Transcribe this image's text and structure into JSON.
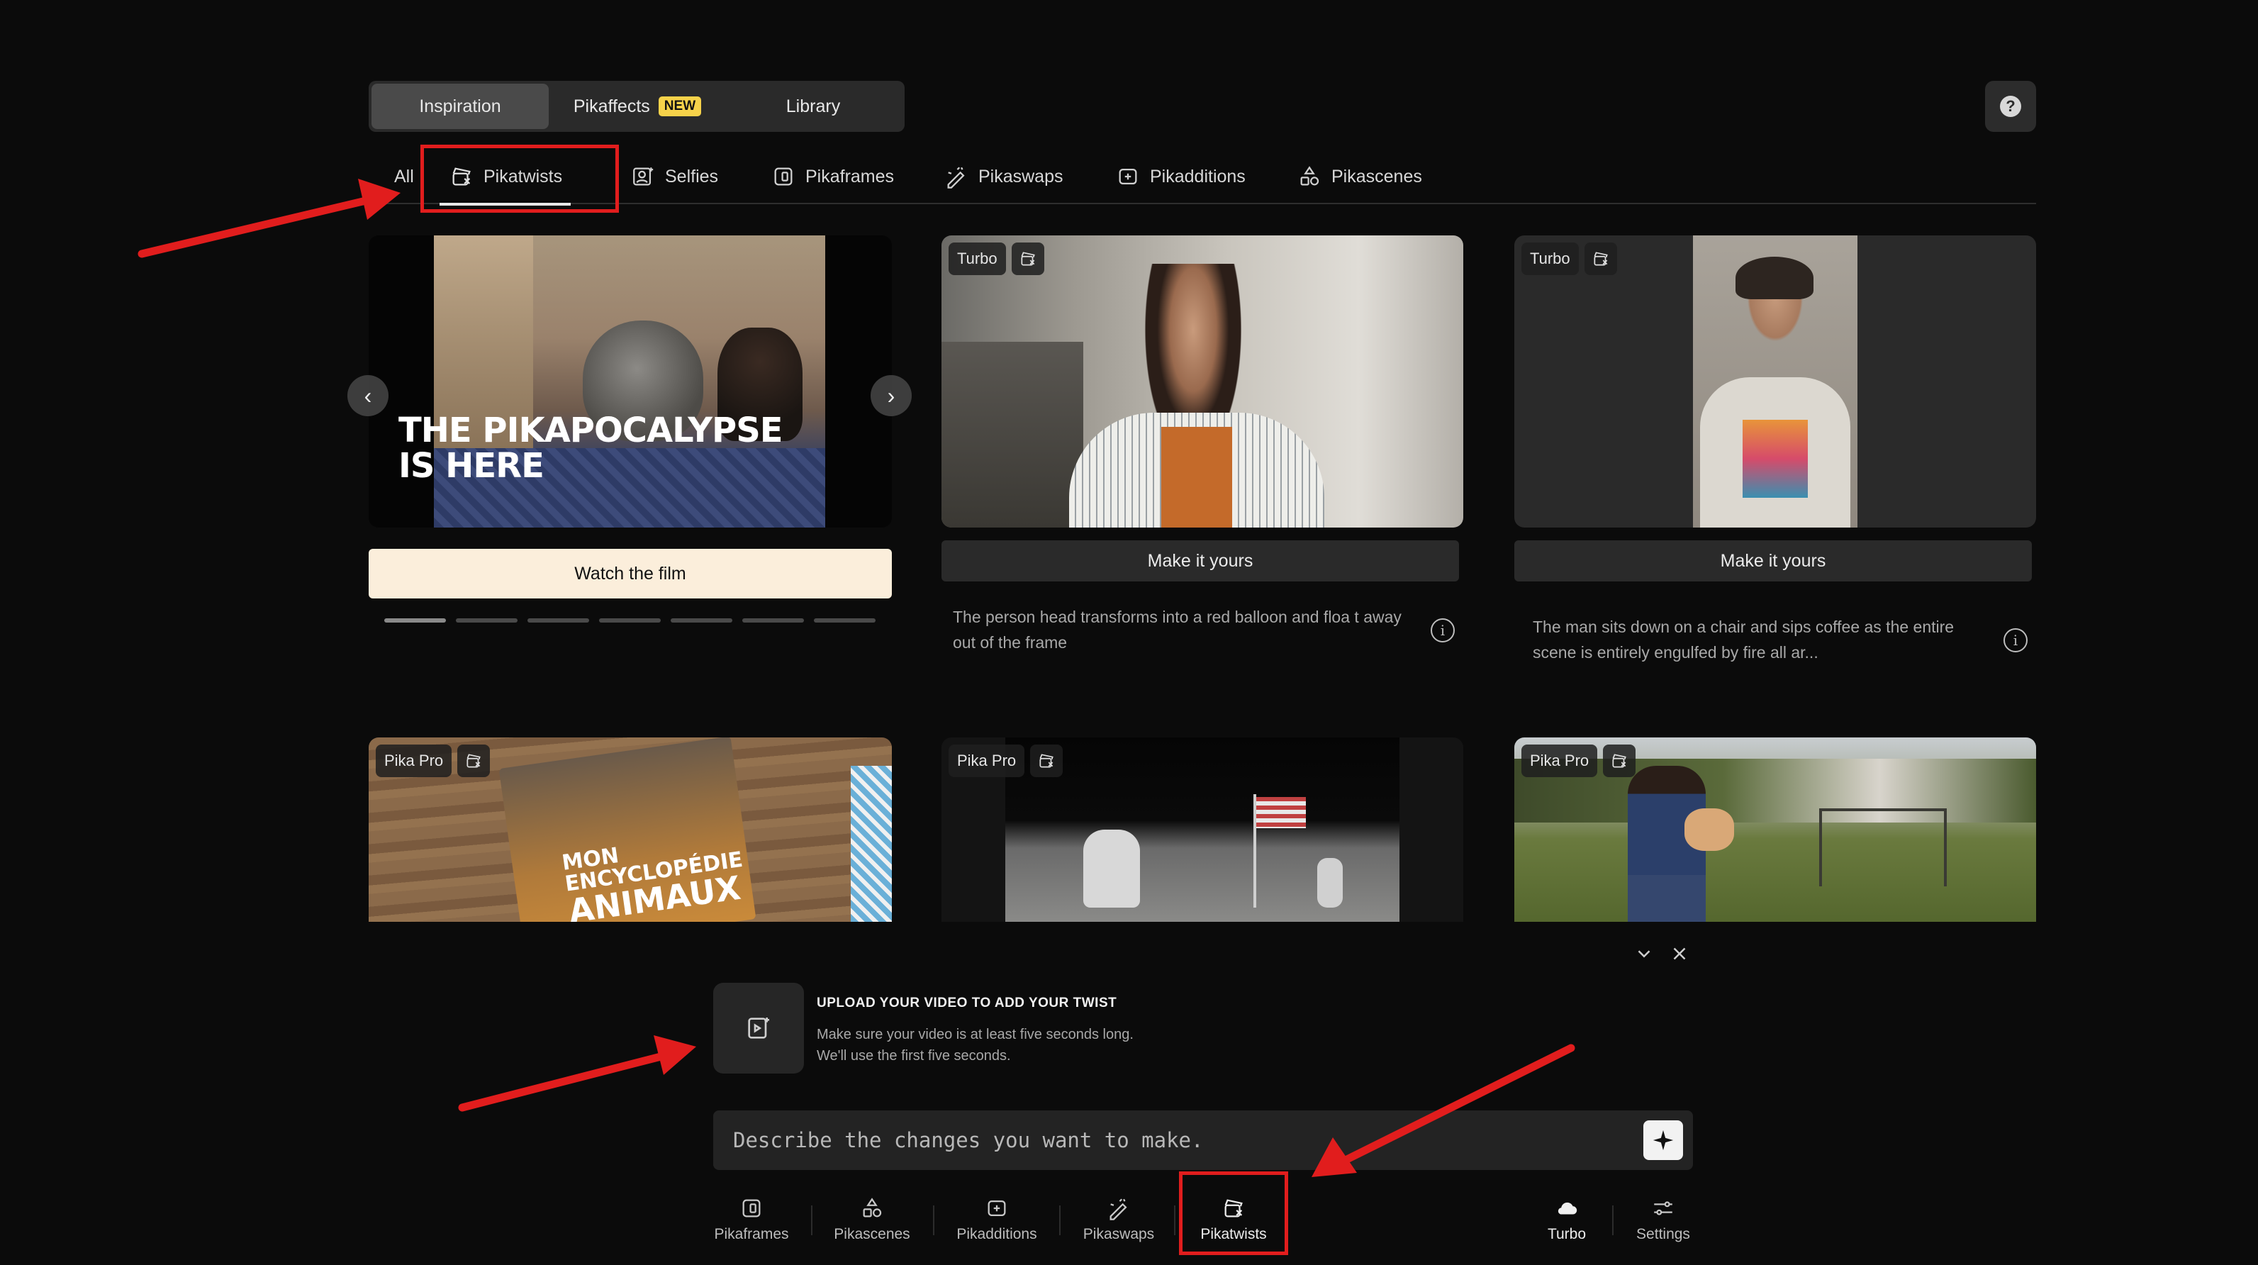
{
  "top_tabs": [
    {
      "label": "Inspiration",
      "active": true
    },
    {
      "label": "Pikaffects",
      "badge": "NEW"
    },
    {
      "label": "Library"
    }
  ],
  "help": {
    "label": "?"
  },
  "categories": [
    {
      "label": "All",
      "icon": ""
    },
    {
      "label": "Pikatwists",
      "icon": "pikatwists-icon",
      "active": true
    },
    {
      "label": "Selfies",
      "icon": "selfie-icon"
    },
    {
      "label": "Pikaframes",
      "icon": "pikaframes-icon"
    },
    {
      "label": "Pikaswaps",
      "icon": "pikaswaps-icon"
    },
    {
      "label": "Pikadditions",
      "icon": "pikadditions-icon"
    },
    {
      "label": "Pikascenes",
      "icon": "pikascenes-icon"
    }
  ],
  "hero": {
    "title_line1": "THE PIKAPOCALYPSE",
    "title_line2": "IS HERE",
    "watch_label": "Watch the film",
    "slide_count": 7,
    "active_slide": 0
  },
  "cards": [
    {
      "badge": "Turbo",
      "button": "Make it yours",
      "description": "The person head transforms into a red balloon and floa t away out of the frame"
    },
    {
      "badge": "Turbo",
      "button": "Make it yours",
      "description": "The man sits down on a chair and sips coffee as the entire scene is entirely engulfed by fire all ar..."
    },
    {
      "badge": "Pika Pro",
      "overlay_line1": "MON",
      "overlay_line2": "ENCYCLOPÉDIE",
      "overlay_line3": "ANIMAUX"
    },
    {
      "badge": "Pika Pro"
    },
    {
      "badge": "Pika Pro"
    }
  ],
  "upload": {
    "title": "UPLOAD YOUR VIDEO TO ADD YOUR TWIST",
    "line1": "Make sure your video is at least five seconds long.",
    "line2": "We'll use the first five seconds."
  },
  "prompt": {
    "placeholder": "Describe the changes you want to make."
  },
  "toolbar": [
    {
      "label": "Pikaframes",
      "icon": "pikaframes-icon"
    },
    {
      "label": "Pikascenes",
      "icon": "pikascenes-icon"
    },
    {
      "label": "Pikadditions",
      "icon": "pikadditions-icon"
    },
    {
      "label": "Pikaswaps",
      "icon": "pikaswaps-icon"
    },
    {
      "label": "Pikatwists",
      "icon": "pikatwists-icon",
      "active": true
    },
    {
      "label": "Turbo",
      "icon": "turbo-cloud-icon"
    },
    {
      "label": "Settings",
      "icon": "settings-sliders-icon"
    }
  ],
  "colors": {
    "annotation_red": "#e11d1d",
    "badge_yellow": "#f6d24a",
    "watch_button": "#fbeedb",
    "background": "#0b0b0b"
  }
}
